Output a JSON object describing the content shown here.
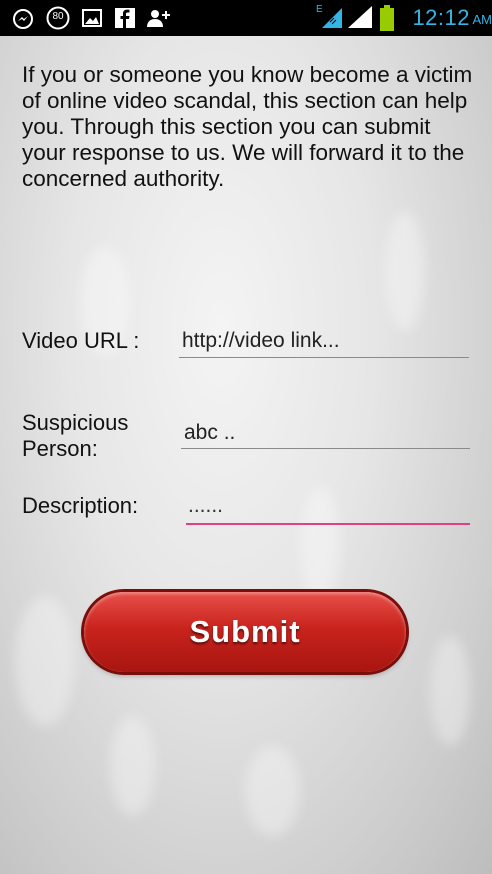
{
  "status_bar": {
    "notification_count": "80",
    "network_type": "E",
    "time": "12:12",
    "ampm": "AM"
  },
  "intro_text": "If you or someone you know become a victim of online video scandal, this section can help you. Through this section you can submit your response to us. We will forward it to the concerned authority.",
  "form": {
    "video_url_label": "Video URL :",
    "video_url_placeholder": "http://video link...",
    "suspicious_person_label_line1": "Suspicious",
    "suspicious_person_label_line2": "Person:",
    "suspicious_person_placeholder": "abc ..",
    "description_label": "Description:",
    "description_placeholder": "......"
  },
  "submit_label": "Submit",
  "colors": {
    "accent_underline": "#e23f84",
    "submit_button": "#c9231d",
    "clock": "#34b5e5"
  }
}
